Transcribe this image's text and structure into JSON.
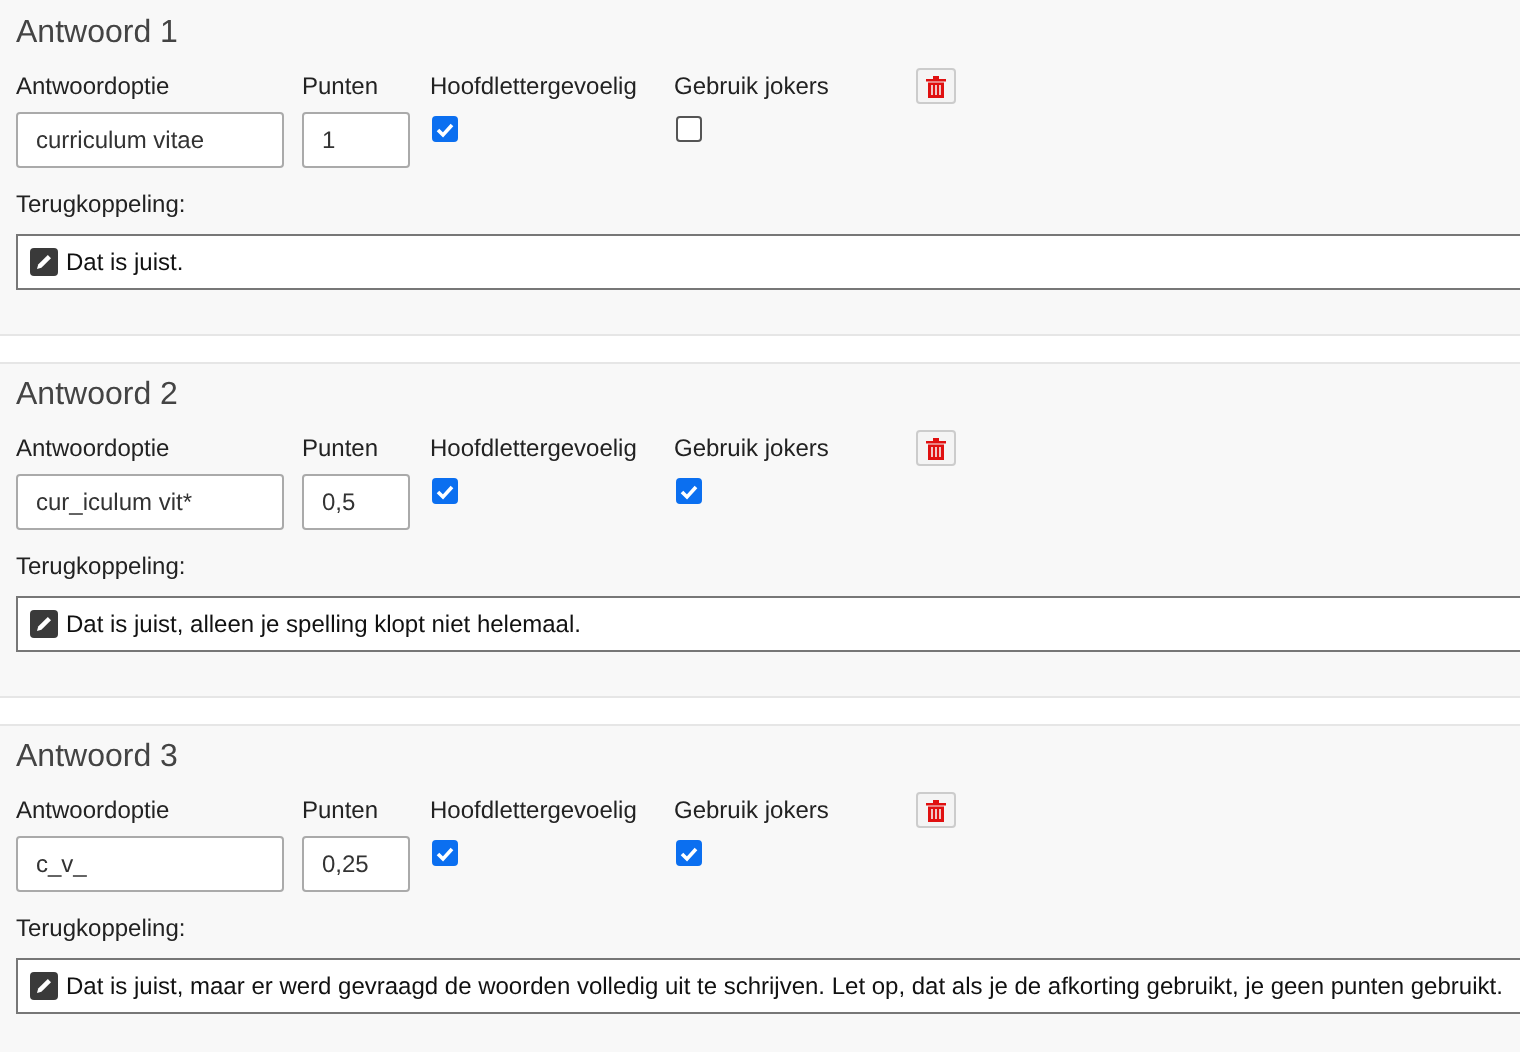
{
  "answers": [
    {
      "title": "Antwoord 1",
      "option_label": "Antwoordoptie",
      "option_value": "curriculum vitae",
      "points_label": "Punten",
      "points_value": "1",
      "case_label": "Hoofdlettergevoelig",
      "case_sensitive": true,
      "jokers_label": "Gebruik jokers",
      "use_jokers": false,
      "feedback_label": "Terugkoppeling:",
      "feedback": "Dat is juist."
    },
    {
      "title": "Antwoord 2",
      "option_label": "Antwoordoptie",
      "option_value": "cur_iculum vit*",
      "points_label": "Punten",
      "points_value": "0,5",
      "case_label": "Hoofdlettergevoelig",
      "case_sensitive": true,
      "jokers_label": "Gebruik jokers",
      "use_jokers": true,
      "feedback_label": "Terugkoppeling:",
      "feedback": "Dat is juist, alleen je spelling klopt niet helemaal."
    },
    {
      "title": "Antwoord 3",
      "option_label": "Antwoordoptie",
      "option_value": "c_v_",
      "points_label": "Punten",
      "points_value": "0,25",
      "case_label": "Hoofdlettergevoelig",
      "case_sensitive": true,
      "jokers_label": "Gebruik jokers",
      "use_jokers": true,
      "feedback_label": "Terugkoppeling:",
      "feedback": "Dat is juist, maar er werd gevraagd de woorden volledig uit te schrijven. Let op, dat als je de afkorting gebruikt, je geen punten gebruikt."
    }
  ]
}
